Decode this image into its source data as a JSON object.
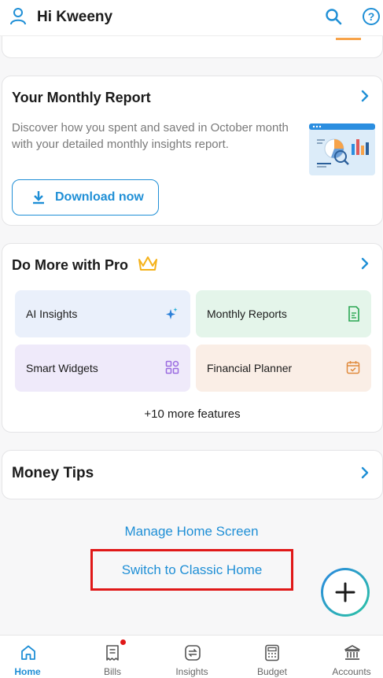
{
  "header": {
    "greeting": "Hi Kweeny"
  },
  "report": {
    "title": "Your Monthly Report",
    "description": "Discover how you spent and saved in October month with your detailed monthly insights report.",
    "download_label": "Download now"
  },
  "pro": {
    "title": "Do More with Pro",
    "features": [
      {
        "label": "AI Insights",
        "icon": "sparkle-icon",
        "color": "#2b7fd8"
      },
      {
        "label": "Monthly Reports",
        "icon": "document-icon",
        "color": "#2aa653"
      },
      {
        "label": "Smart Widgets",
        "icon": "widgets-icon",
        "color": "#9a6be0"
      },
      {
        "label": "Financial Planner",
        "icon": "calendar-icon",
        "color": "#e08a3c"
      }
    ],
    "more_label": "+10 more features"
  },
  "tips": {
    "title": "Money Tips"
  },
  "links": {
    "manage": "Manage Home Screen",
    "classic": "Switch to Classic Home"
  },
  "nav": {
    "items": [
      {
        "label": "Home",
        "icon": "home-icon",
        "active": true
      },
      {
        "label": "Bills",
        "icon": "bills-icon",
        "badge": true
      },
      {
        "label": "Insights",
        "icon": "insights-icon"
      },
      {
        "label": "Budget",
        "icon": "budget-icon"
      },
      {
        "label": "Accounts",
        "icon": "bank-icon"
      }
    ]
  },
  "colors": {
    "accent": "#1f8fd6",
    "highlight_box": "#e01818"
  }
}
